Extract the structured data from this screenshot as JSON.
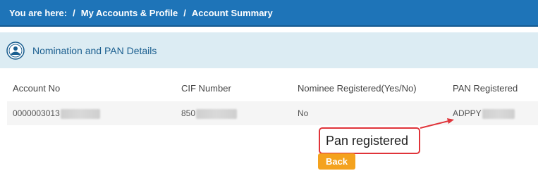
{
  "breadcrumb": {
    "prefix": "You are here:",
    "items": [
      "My Accounts & Profile",
      "Account Summary"
    ],
    "separator": "/"
  },
  "panel": {
    "title": "Nomination and PAN Details",
    "icon": "nomination-icon"
  },
  "table": {
    "headers": [
      "Account No",
      "CIF Number",
      "Nominee Registered(Yes/No)",
      "PAN Registered"
    ],
    "rows": [
      {
        "account_no": "0000003013",
        "cif_number": "850",
        "nominee_registered": "No",
        "pan_registered": "ADPPY"
      }
    ]
  },
  "annotation": {
    "text": "Pan registered",
    "color": "#e0343a"
  },
  "back_button": {
    "label": "Back",
    "color": "#f4a21e"
  },
  "colors": {
    "header_bar": "#1e74b8",
    "panel_bg": "#dcecf3",
    "panel_title": "#1a5e8f"
  }
}
